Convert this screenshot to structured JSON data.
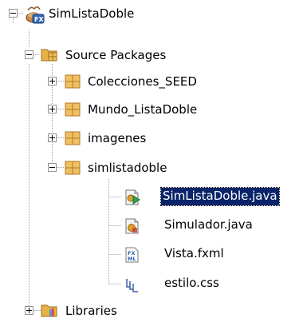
{
  "tree": {
    "project": {
      "label": "SimListaDoble",
      "icon": "javafx-project-icon",
      "expanded": true
    },
    "source_packages": {
      "label": "Source Packages",
      "icon": "source-packages-folder-icon",
      "expanded": true
    },
    "packages": [
      {
        "label": "Colecciones_SEED",
        "icon": "package-icon",
        "expanded": false
      },
      {
        "label": "Mundo_ListaDoble",
        "icon": "package-icon",
        "expanded": false
      },
      {
        "label": "imagenes",
        "icon": "package-icon",
        "expanded": false
      },
      {
        "label": "simlistadoble",
        "icon": "package-icon",
        "expanded": true
      }
    ],
    "files": [
      {
        "label": "SimListaDoble.java",
        "icon": "java-main-class-icon",
        "selected": true
      },
      {
        "label": "Simulador.java",
        "icon": "java-class-icon",
        "selected": false
      },
      {
        "label": "Vista.fxml",
        "icon": "fxml-file-icon",
        "selected": false
      },
      {
        "label": "estilo.css",
        "icon": "css-file-icon",
        "selected": false
      }
    ],
    "libraries": {
      "label": "Libraries",
      "icon": "libraries-folder-icon",
      "expanded": false
    }
  },
  "colors": {
    "selection_background": "#0a246a",
    "selection_text": "#ffffff",
    "guide_line": "#a0a0a0",
    "package_icon": "#e8b04a"
  }
}
